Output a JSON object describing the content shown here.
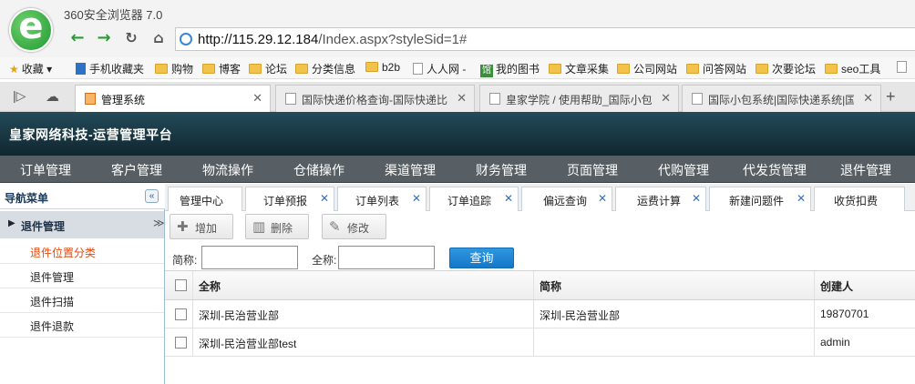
{
  "browser": {
    "title": "360安全浏览器 7.0",
    "url_host": "http://115.29.12.184",
    "url_path": "/Index.aspx?styleSid=1#",
    "bookmarks": [
      "收藏",
      "手机收藏夹",
      "购物",
      "博客",
      "论坛",
      "分类信息",
      "b2b",
      "人人网 -",
      "我的图书",
      "文章采集",
      "公司网站",
      "问答网站",
      "次要论坛",
      "seo工具"
    ],
    "tabs": [
      "管理系统",
      "国际快递价格查询-国际快递比",
      "皇家学院 / 使用帮助_国际小包",
      "国际小包系统|国际快递系统|国"
    ],
    "badge_text": "馆"
  },
  "app": {
    "title": "皇家网络科技-运营管理平台",
    "menu": [
      "订单管理",
      "客户管理",
      "物流操作",
      "仓储操作",
      "渠道管理",
      "财务管理",
      "页面管理",
      "代购管理",
      "代发货管理",
      "退件管理"
    ]
  },
  "sidebar": {
    "header": "导航菜单",
    "group": "退件管理",
    "items": [
      "退件位置分类",
      "退件管理",
      "退件扫描",
      "退件退款"
    ]
  },
  "tabs": [
    "管理中心",
    "订单预报",
    "订单列表",
    "订单追踪",
    "偏远查询",
    "运费计算",
    "新建问题件",
    "收货扣费"
  ],
  "toolbar": {
    "add": "增加",
    "delete": "删除",
    "edit": "修改"
  },
  "search": {
    "short_label": "简称:",
    "full_label": "全称:",
    "button": "查询",
    "short_value": "",
    "full_value": ""
  },
  "grid": {
    "columns": [
      "全称",
      "简称",
      "创建人"
    ],
    "rows": [
      {
        "full": "深圳-民治营业部",
        "short": "深圳-民治营业部",
        "creator": "19870701"
      },
      {
        "full": "深圳-民治营业部test",
        "short": "",
        "creator": "admin"
      }
    ]
  },
  "colors": {
    "header": "#17323e",
    "menubar": "#575f64",
    "active_link": "#e34a11",
    "query_button": "#1a82d4"
  }
}
